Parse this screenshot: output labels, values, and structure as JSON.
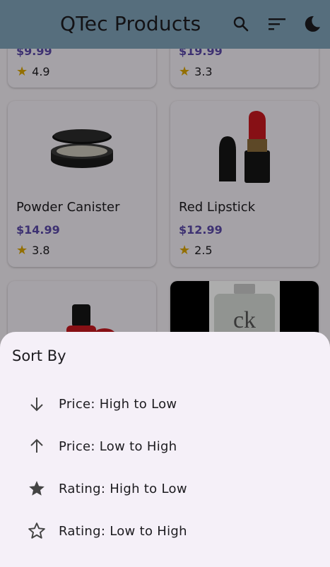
{
  "app": {
    "title": "QTec Products",
    "icons": [
      "search-icon",
      "sort-icon",
      "dark-mode-icon"
    ]
  },
  "products": [
    {
      "name": "",
      "price": "$9.99",
      "rating": "4.9"
    },
    {
      "name": "",
      "price": "$19.99",
      "rating": "3.3"
    },
    {
      "name": "Powder Canister",
      "price": "$14.99",
      "rating": "3.8"
    },
    {
      "name": "Red Lipstick",
      "price": "$12.99",
      "rating": "2.5"
    }
  ],
  "sort_sheet": {
    "title": "Sort By",
    "options": [
      {
        "label": "Price: High to Low",
        "icon": "arrow-down-icon"
      },
      {
        "label": "Price: Low to High",
        "icon": "arrow-up-icon"
      },
      {
        "label": "Rating: High to Low",
        "icon": "star-filled-icon"
      },
      {
        "label": "Rating: Low to High",
        "icon": "star-outline-icon"
      }
    ]
  },
  "colors": {
    "appbar": "#7fa3b8",
    "price": "#5b49a8",
    "star": "#d9a400",
    "sheet": "#f5f0f8"
  }
}
